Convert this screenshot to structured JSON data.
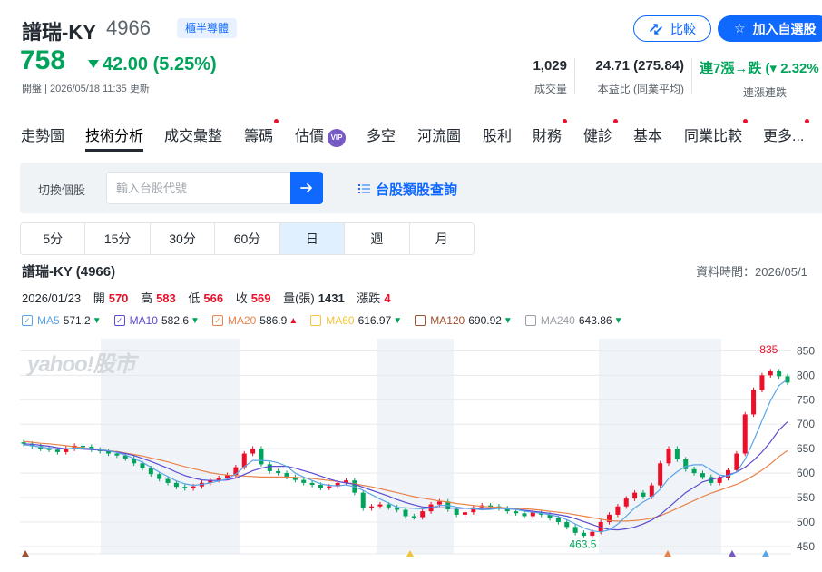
{
  "stock": {
    "name": "譜瑞-KY",
    "code": "4966",
    "tag": "櫃半導體",
    "price": "758",
    "change": "42.00 (5.25%)",
    "market_status": "開盤 | 2026/05/18 11:35 更新"
  },
  "buttons": {
    "compare": "比較",
    "add_watchlist": "加入自選股"
  },
  "stats": [
    {
      "value": "1,029",
      "label": "成交量"
    },
    {
      "value": "24.71 (275.84)",
      "label": "本益比 (同業平均)"
    },
    {
      "value": "連7漲→跌 (▾ 2.32%",
      "label": "連漲連跌"
    }
  ],
  "tabs": [
    {
      "label": "走勢圖",
      "dot": false
    },
    {
      "label": "技術分析",
      "dot": false
    },
    {
      "label": "成交彙整",
      "dot": false
    },
    {
      "label": "籌碼",
      "dot": true
    },
    {
      "label": "估價",
      "dot": false,
      "vip": "VIP"
    },
    {
      "label": "多空",
      "dot": false
    },
    {
      "label": "河流圖",
      "dot": false
    },
    {
      "label": "股利",
      "dot": false
    },
    {
      "label": "財務",
      "dot": true
    },
    {
      "label": "健診",
      "dot": true
    },
    {
      "label": "基本",
      "dot": false
    },
    {
      "label": "同業比較",
      "dot": true
    },
    {
      "label": "更多...",
      "dot": true
    }
  ],
  "search": {
    "label": "切換個股",
    "placeholder": "輸入台股代號",
    "category_link": "台股類股查詢"
  },
  "periods": [
    "5分",
    "15分",
    "30分",
    "60分",
    "日",
    "週",
    "月"
  ],
  "active_period": "日",
  "chart_header": {
    "title": "譜瑞-KY (4966)",
    "data_time": "資料時間：2026/05/1"
  },
  "ohlc": {
    "date": "2026/01/23",
    "open_label": "開",
    "open": "570",
    "high_label": "高",
    "high": "583",
    "low_label": "低",
    "low": "566",
    "close_label": "收",
    "close": "569",
    "vol_label": "量(張)",
    "vol": "1431",
    "chg_label": "漲跌",
    "chg": "4"
  },
  "moving_averages": [
    {
      "name": "MA5",
      "value": "571.2",
      "dir": "down",
      "color": "#5ba4e6"
    },
    {
      "name": "MA10",
      "value": "582.6",
      "dir": "down",
      "color": "#5a4bcf"
    },
    {
      "name": "MA20",
      "value": "586.9",
      "dir": "up",
      "color": "#e8834a"
    },
    {
      "name": "MA60",
      "value": "616.97",
      "dir": "down",
      "color": "#f0c43a"
    },
    {
      "name": "MA120",
      "value": "690.92",
      "dir": "down",
      "color": "#a0522d"
    },
    {
      "name": "MA240",
      "value": "643.86",
      "dir": "down",
      "color": "#9aa0a6"
    }
  ],
  "colors": {
    "up": "#eb0f29",
    "down": "#00a35a",
    "accent": "#0f69ff"
  },
  "chart_data": {
    "type": "line",
    "watermark": "yahoo!股市",
    "y_ticks": [
      850,
      800,
      750,
      700,
      650,
      600,
      550,
      500,
      450
    ],
    "ylim": [
      435,
      860
    ],
    "annotations": {
      "max": "835",
      "min": "463.5"
    },
    "close": [
      660,
      655,
      650,
      648,
      643,
      650,
      656,
      654,
      648,
      645,
      640,
      636,
      630,
      620,
      610,
      598,
      588,
      580,
      572,
      569,
      573,
      580,
      586,
      590,
      596,
      612,
      640,
      650,
      618,
      604,
      600,
      592,
      586,
      580,
      576,
      570,
      573,
      580,
      585,
      560,
      528,
      532,
      536,
      530,
      525,
      512,
      510,
      522,
      536,
      542,
      526,
      515,
      520,
      530,
      534,
      532,
      528,
      522,
      518,
      512,
      520,
      515,
      508,
      500,
      490,
      478,
      472,
      480,
      500,
      515,
      532,
      548,
      560,
      552,
      575,
      620,
      650,
      628,
      608,
      600,
      592,
      580,
      590,
      606,
      640,
      720,
      770,
      800,
      808,
      798,
      785
    ],
    "ma5": [
      658,
      656,
      653,
      651,
      649,
      650,
      651,
      651,
      650,
      648,
      646,
      642,
      637,
      630,
      622,
      612,
      602,
      593,
      584,
      578,
      575,
      577,
      580,
      584,
      588,
      598,
      613,
      626,
      626,
      625,
      621,
      614,
      600,
      592,
      585,
      578,
      575,
      574,
      576,
      572,
      565,
      556,
      547,
      539,
      530,
      529,
      528,
      527,
      529,
      534,
      534,
      531,
      528,
      527,
      525,
      526,
      528,
      527,
      526,
      522,
      520,
      518,
      515,
      511,
      505,
      496,
      488,
      482,
      480,
      484,
      496,
      512,
      529,
      541,
      551,
      567,
      589,
      603,
      614,
      617,
      617,
      606,
      596,
      594,
      602,
      628,
      666,
      707,
      748,
      779,
      792
    ],
    "ma10": [
      660,
      659,
      657,
      655,
      652,
      650,
      650,
      649,
      648,
      647,
      645,
      643,
      640,
      636,
      630,
      624,
      617,
      610,
      602,
      595,
      590,
      586,
      585,
      585,
      586,
      590,
      597,
      605,
      610,
      614,
      614,
      614,
      610,
      605,
      600,
      594,
      588,
      583,
      580,
      577,
      571,
      565,
      559,
      553,
      546,
      540,
      535,
      531,
      530,
      529,
      529,
      528,
      528,
      528,
      528,
      528,
      528,
      527,
      526,
      524,
      522,
      520,
      518,
      515,
      512,
      507,
      501,
      495,
      489,
      485,
      484,
      486,
      490,
      496,
      504,
      515,
      530,
      545,
      560,
      571,
      582,
      587,
      591,
      596,
      602,
      612,
      626,
      643,
      664,
      688,
      705
    ],
    "ma20": [
      665,
      663,
      661,
      660,
      658,
      656,
      654,
      652,
      650,
      648,
      646,
      644,
      641,
      638,
      635,
      631,
      627,
      623,
      618,
      613,
      609,
      605,
      601,
      598,
      596,
      595,
      594,
      593,
      592,
      592,
      592,
      592,
      591,
      590,
      589,
      587,
      585,
      583,
      580,
      578,
      575,
      572,
      568,
      564,
      560,
      556,
      552,
      549,
      546,
      543,
      541,
      538,
      536,
      534,
      532,
      531,
      530,
      529,
      528,
      527,
      526,
      524,
      522,
      520,
      518,
      515,
      512,
      509,
      506,
      503,
      502,
      502,
      503,
      505,
      508,
      513,
      520,
      528,
      536,
      544,
      552,
      559,
      565,
      571,
      577,
      585,
      595,
      606,
      619,
      634,
      646
    ]
  }
}
